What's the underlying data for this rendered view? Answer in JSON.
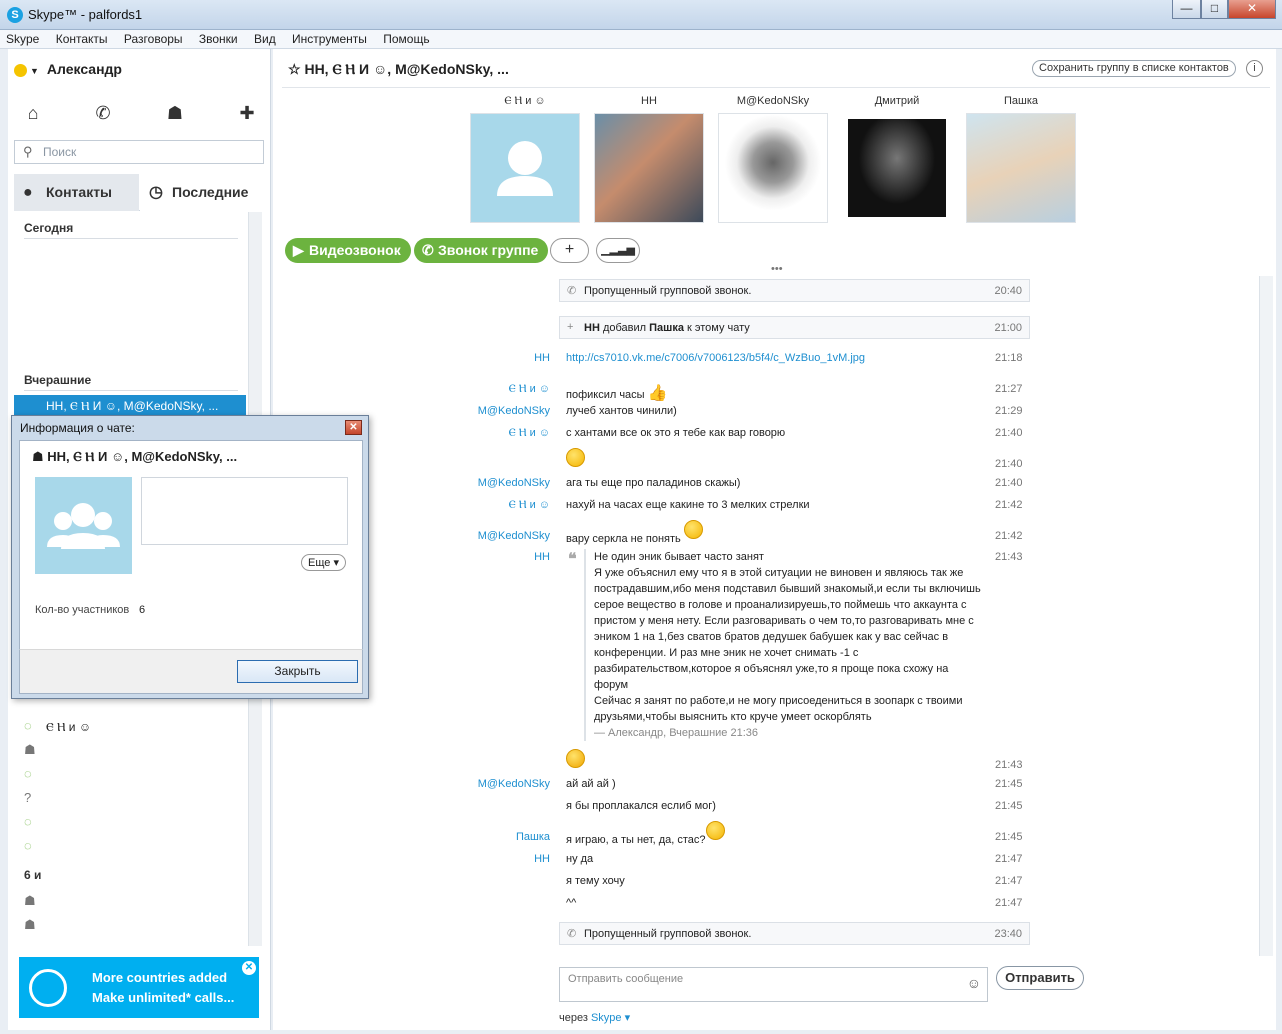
{
  "window": {
    "title": "Skype™ - palfords1",
    "min": "—",
    "max": "□",
    "close": "✕"
  },
  "menu": [
    "Skype",
    "Контакты",
    "Разговоры",
    "Звонки",
    "Вид",
    "Инструменты",
    "Помощь"
  ],
  "profile": {
    "name": "Александр"
  },
  "search": {
    "placeholder": "Поиск"
  },
  "tabs": {
    "contacts": "Контакты",
    "recent": "Последние"
  },
  "recent_list": {
    "today": "Сегодня",
    "yesterday": "Вчерашние",
    "selected": "НН, Ⲉ Ⲏ И ☺, M@KedoNSky, ...",
    "rows": [
      "Ⲉ Ⲏ и ☺"
    ],
    "section3": "6 и"
  },
  "ad": {
    "line1": "More countries added",
    "line2": "Make unlimited* calls...",
    "close": "✕"
  },
  "chat_header": {
    "title": "НН, Ⲉ Ⲏ И ☺, M@KedoNSky, ...",
    "save_group": "Сохранить группу в списке контактов",
    "info": "i"
  },
  "participants": [
    {
      "name": "Ⲉ Ⲏ и ☺",
      "status": "online"
    },
    {
      "name": "НН",
      "status": "online"
    },
    {
      "name": "M@KedoNSky",
      "status": "unknown"
    },
    {
      "name": "Дмитрий",
      "status": "unknown"
    },
    {
      "name": "Пашка",
      "status": "unknown"
    }
  ],
  "actions": {
    "video": "Видеозвонок",
    "group_call": "Звонок группе",
    "add": "+",
    "signal": "📶"
  },
  "messages": {
    "sys1": {
      "text": "Пропущенный групповой звонок.",
      "time": "20:40"
    },
    "sys2": {
      "text1": "НН",
      "text2": " добавил ",
      "text3": "Пашка",
      "text4": " к этому чату",
      "time": "21:00"
    },
    "m1": {
      "sender": "НН",
      "text": "http://cs7010.vk.me/c7006/v7006123/b5f4/c_WzBuo_1vM.jpg",
      "time": "21:18"
    },
    "m2": {
      "sender": "Ⲉ Ⲏ и ☺",
      "text": "пофиксил часы",
      "time": "21:27"
    },
    "m3": {
      "sender": "M@KedoNSky",
      "text": "лучеб хантов чинили)",
      "time": "21:29"
    },
    "m4": {
      "sender": "Ⲉ Ⲏ и ☺",
      "text": "с хантами все ок это я тебе как вар говорю",
      "time": "21:40"
    },
    "m5": {
      "time": "21:40"
    },
    "m6": {
      "sender": "M@KedoNSky",
      "text": "ага ты еще про паладинов скажы)",
      "time": "21:40"
    },
    "m7": {
      "sender": "Ⲉ Ⲏ и ☺",
      "text": "нахуй на часах еще какине то 3 мелких стрелки",
      "time": "21:42"
    },
    "m8": {
      "sender": "M@KedoNSky",
      "text": "вару серкла не понять",
      "time": "21:42"
    },
    "m9": {
      "sender": "НН",
      "time": "21:43",
      "quote": [
        "Не один эник бывает часто занят",
        "Я уже объяснил ему что я в этой ситуации не виновен и являюсь так же",
        "пострадавшим,ибо меня подставил бывший знакомый,и если ты включишь",
        "серое вещество в голове и проанализируешь,то поймешь что аккаунта с",
        "пристом у меня нету. Если разговаривать о чем то,то разговаривать мне с",
        "эником 1 на 1,без сватов братов дедушек бабушек как у вас сейчас в",
        "конференции. И раз мне эник не хочет снимать -1 с",
        "разбирательством,которое я объяснял уже,то я проще пока схожу на",
        "форум",
        "Сейчас я занят по работе,и не могу присоедениться в зоопарк с твоими",
        "друзьями,чтобы выяснить кто круче умеет оскорблять"
      ],
      "quote_footer": "— Александр, Вчерашние 21:36"
    },
    "m10": {
      "time": "21:43"
    },
    "m11": {
      "sender": "M@KedoNSky",
      "text": "ай ай ай )",
      "time": "21:45"
    },
    "m12": {
      "text": "я бы проплакался еслиб мог)",
      "time": "21:45"
    },
    "m13": {
      "sender": "Пашка",
      "text": "я играю, а ты нет, да, стас?",
      "time": "21:45"
    },
    "m14": {
      "sender": "НН",
      "text": "ну да",
      "time": "21:47"
    },
    "m15": {
      "text": "я тему хочу",
      "time": "21:47"
    },
    "m16": {
      "text": "^^",
      "time": "21:47"
    },
    "sys3": {
      "text": "Пропущенный групповой звонок.",
      "time": "23:40"
    }
  },
  "compose": {
    "placeholder": "Отправить сообщение",
    "send": "Отправить",
    "via_label": "через ",
    "via_service": "Skype"
  },
  "dialog": {
    "title": "Информация о чате:",
    "chat_name": "НН, Ⲉ Ⲏ И ☺, M@KedoNSky, ...",
    "more": "Еще",
    "members_label": "Кол-во участников",
    "members_count": "6",
    "close_btn": "Закрыть"
  },
  "colors": {
    "accent": "#1e8fd0",
    "green": "#6cb33f",
    "ad": "#00aff0"
  }
}
